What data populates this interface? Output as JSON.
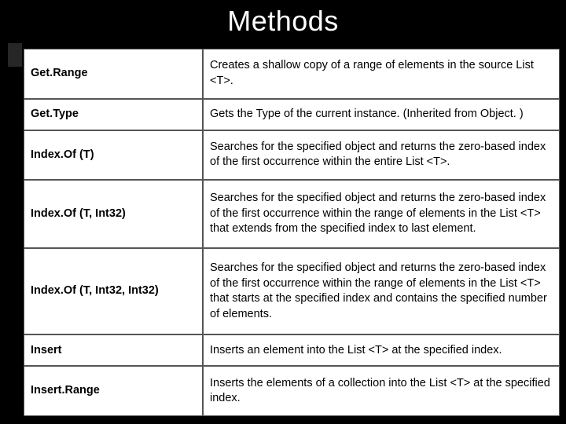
{
  "title": "Methods",
  "rows": [
    {
      "name": "Get.Range",
      "desc": "Creates a shallow copy of a range of elements in the source List <T>."
    },
    {
      "name": "Get.Type",
      "desc": "Gets the Type of the current instance. (Inherited from Object. )"
    },
    {
      "name": "Index.Of (T)",
      "desc": "Searches for the specified object and returns the zero-based index of the first occurrence within the entire List <T>."
    },
    {
      "name": "Index.Of (T, Int32)",
      "desc": "Searches for the specified object and returns the zero-based index of the first occurrence within the range of elements in the List <T> that extends from the specified index to last element."
    },
    {
      "name": "Index.Of (T, Int32, Int32)",
      "desc": "Searches for the specified object and returns the zero-based index of the first occurrence within the range of elements in the List <T> that starts at the specified index and contains the specified number of elements."
    },
    {
      "name": "Insert",
      "desc": "Inserts an element into the List <T> at the specified index."
    },
    {
      "name": "Insert.Range",
      "desc": "Inserts the elements of a collection into the List <T> at the specified index."
    }
  ]
}
